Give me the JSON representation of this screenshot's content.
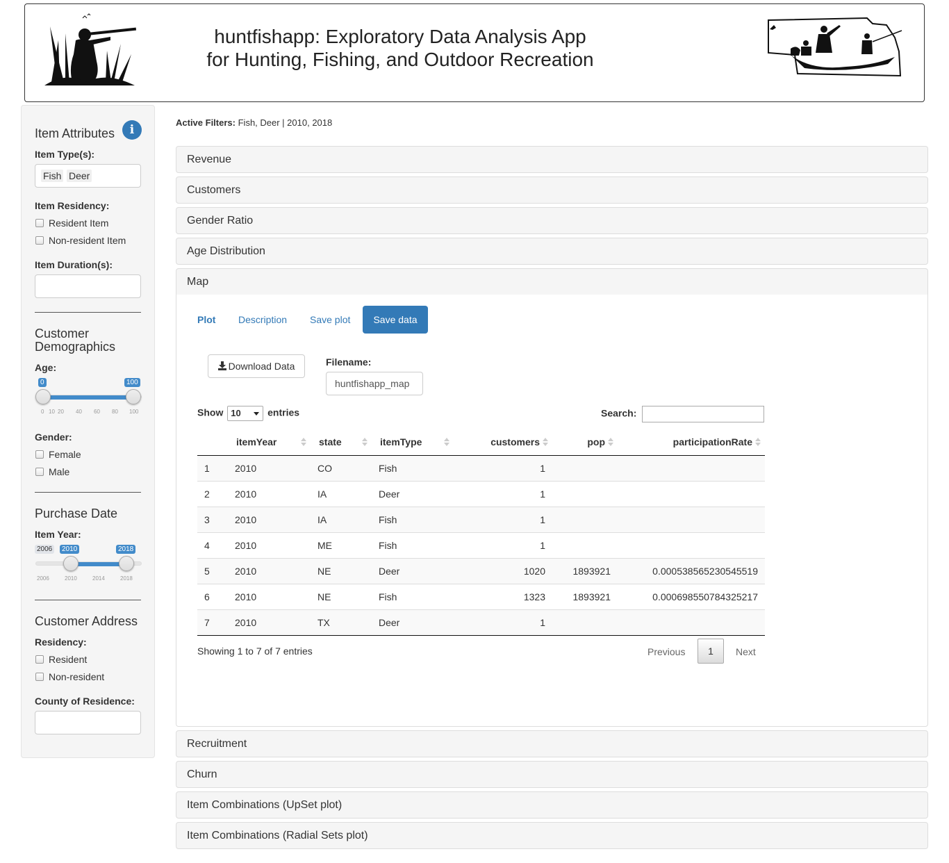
{
  "header": {
    "title_line1": "huntfishapp: Exploratory Data Analysis App",
    "title_line2": "for Hunting, Fishing, and Outdoor Recreation"
  },
  "sidebar": {
    "item_attributes": "Item Attributes",
    "item_types_label": "Item Type(s):",
    "item_types": [
      "Fish",
      "Deer"
    ],
    "item_residency_label": "Item Residency:",
    "resident_item": "Resident Item",
    "nonresident_item": "Non-resident Item",
    "item_duration_label": "Item Duration(s):",
    "customer_demographics": "Customer Demographics",
    "age_label": "Age:",
    "age_min": "0",
    "age_max": "100",
    "age_ticks": [
      "0",
      "10",
      "20",
      "40",
      "60",
      "80",
      "100"
    ],
    "gender_label": "Gender:",
    "female": "Female",
    "male": "Male",
    "purchase_date": "Purchase Date",
    "item_year_label": "Item Year:",
    "year_grid_min": "2006",
    "year_from": "2010",
    "year_to": "2018",
    "year_ticks": [
      "2006",
      "2010",
      "2014",
      "2018"
    ],
    "customer_address": "Customer Address",
    "residency_label": "Residency:",
    "resident": "Resident",
    "nonresident": "Non-resident",
    "county_label": "County of Residence:",
    "info_icon_glyph": "i"
  },
  "active_filters": {
    "label": "Active Filters:",
    "value": "Fish, Deer | 2010, 2018"
  },
  "panels": {
    "revenue": "Revenue",
    "customers": "Customers",
    "gender_ratio": "Gender Ratio",
    "age_distribution": "Age Distribution",
    "map": "Map",
    "recruitment": "Recruitment",
    "churn": "Churn",
    "upset": "Item Combinations (UpSet plot)",
    "radial": "Item Combinations (Radial Sets plot)"
  },
  "tabs": {
    "plot": "Plot",
    "description": "Description",
    "save_plot": "Save plot",
    "save_data": "Save data"
  },
  "download": {
    "button": "Download Data",
    "filename_label": "Filename:",
    "filename_value": "huntfishapp_map"
  },
  "table": {
    "show": "Show",
    "length": "10",
    "entries": "entries",
    "search_label": "Search:",
    "headers": [
      "itemYear",
      "state",
      "itemType",
      "customers",
      "pop",
      "participationRate"
    ],
    "rows": [
      [
        "1",
        "2010",
        "CO",
        "Fish",
        "1",
        "",
        ""
      ],
      [
        "2",
        "2010",
        "IA",
        "Deer",
        "1",
        "",
        ""
      ],
      [
        "3",
        "2010",
        "IA",
        "Fish",
        "1",
        "",
        ""
      ],
      [
        "4",
        "2010",
        "ME",
        "Fish",
        "1",
        "",
        ""
      ],
      [
        "5",
        "2010",
        "NE",
        "Deer",
        "1020",
        "1893921",
        "0.000538565230545519"
      ],
      [
        "6",
        "2010",
        "NE",
        "Fish",
        "1323",
        "1893921",
        "0.000698550784325217"
      ],
      [
        "7",
        "2010",
        "TX",
        "Deer",
        "1",
        "",
        ""
      ]
    ],
    "info": "Showing 1 to 7 of 7 entries",
    "previous": "Previous",
    "page": "1",
    "next": "Next"
  },
  "colors": {
    "primary": "#337ab7",
    "slider": "#428bca",
    "panel_bg": "#f5f5f5"
  }
}
